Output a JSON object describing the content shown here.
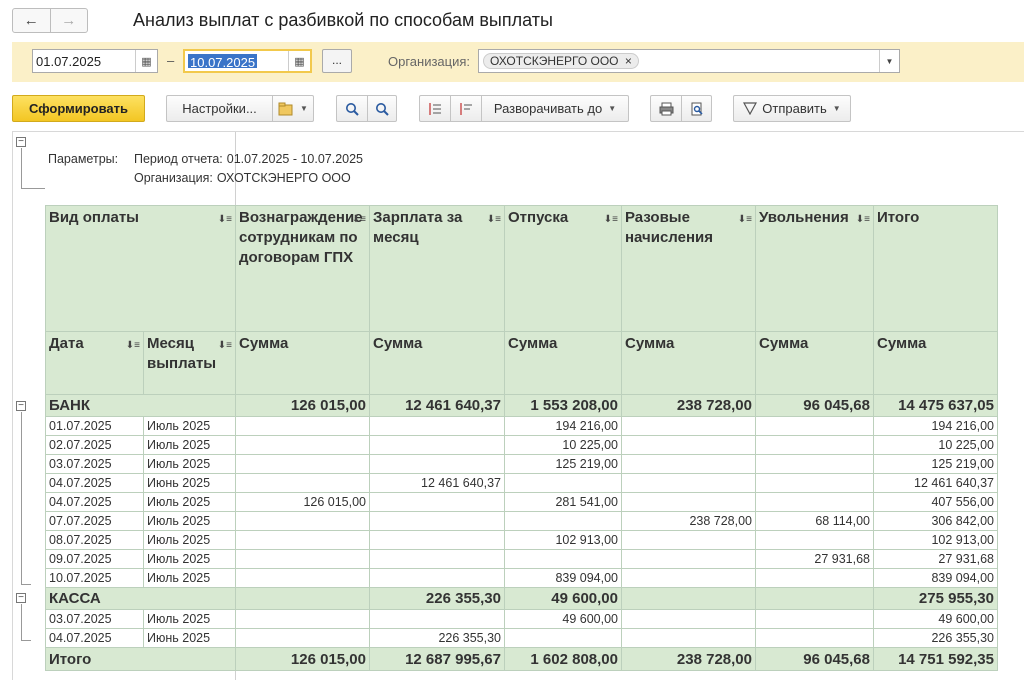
{
  "nav": {
    "back_glyph": "←",
    "fwd_glyph": "→"
  },
  "title": "Анализ выплат с разбивкой по способам выплаты",
  "filters": {
    "date_from": "01.07.2025",
    "date_sep": "–",
    "date_to": "10.07.2025",
    "ellipsis": "...",
    "org_label": "Организация:",
    "org_value": "ОХОТСКЭНЕРГО ООО",
    "org_remove": "×"
  },
  "toolbar": {
    "generate": "Сформировать",
    "settings": "Настройки...",
    "expand_to": "Разворачивать до",
    "send": "Отправить"
  },
  "params": {
    "label": "Параметры:",
    "period_label": "Период отчета:",
    "period_value": "01.07.2025 - 10.07.2025",
    "org_label": "Организация:",
    "org_value": "ОХОТСКЭНЕРГО ООО"
  },
  "table": {
    "headers": {
      "vid": "Вид оплаты",
      "col1": "Вознаграждение сотрудникам по договорам ГПХ",
      "col2": "Зарплата за месяц",
      "col3": "Отпуска",
      "col4": "Разовые начисления",
      "col5": "Увольнения",
      "col6": "Итого",
      "date": "Дата",
      "month": "Месяц выплаты",
      "sum": "Сумма"
    },
    "groups": [
      {
        "name": "БАНК",
        "totals": [
          "126 015,00",
          "12 461 640,37",
          "1 553 208,00",
          "238 728,00",
          "96 045,68",
          "14 475 637,05"
        ],
        "rows": [
          {
            "date": "01.07.2025",
            "month": "Июль 2025",
            "vals": [
              "",
              "",
              "194 216,00",
              "",
              "",
              "194 216,00"
            ]
          },
          {
            "date": "02.07.2025",
            "month": "Июль 2025",
            "vals": [
              "",
              "",
              "10 225,00",
              "",
              "",
              "10 225,00"
            ]
          },
          {
            "date": "03.07.2025",
            "month": "Июль 2025",
            "vals": [
              "",
              "",
              "125 219,00",
              "",
              "",
              "125 219,00"
            ]
          },
          {
            "date": "04.07.2025",
            "month": "Июнь 2025",
            "vals": [
              "",
              "12 461 640,37",
              "",
              "",
              "",
              "12 461 640,37"
            ]
          },
          {
            "date": "04.07.2025",
            "month": "Июль 2025",
            "vals": [
              "126 015,00",
              "",
              "281 541,00",
              "",
              "",
              "407 556,00"
            ]
          },
          {
            "date": "07.07.2025",
            "month": "Июль 2025",
            "vals": [
              "",
              "",
              "",
              "238 728,00",
              "68 114,00",
              "306 842,00"
            ]
          },
          {
            "date": "08.07.2025",
            "month": "Июль 2025",
            "vals": [
              "",
              "",
              "102 913,00",
              "",
              "",
              "102 913,00"
            ]
          },
          {
            "date": "09.07.2025",
            "month": "Июль 2025",
            "vals": [
              "",
              "",
              "",
              "",
              "27 931,68",
              "27 931,68"
            ]
          },
          {
            "date": "10.07.2025",
            "month": "Июль 2025",
            "vals": [
              "",
              "",
              "839 094,00",
              "",
              "",
              "839 094,00"
            ]
          }
        ]
      },
      {
        "name": "КАССА",
        "totals": [
          "",
          "226 355,30",
          "49 600,00",
          "",
          "",
          "275 955,30"
        ],
        "rows": [
          {
            "date": "03.07.2025",
            "month": "Июль 2025",
            "vals": [
              "",
              "",
              "49 600,00",
              "",
              "",
              "49 600,00"
            ]
          },
          {
            "date": "04.07.2025",
            "month": "Июнь 2025",
            "vals": [
              "",
              "226 355,30",
              "",
              "",
              "",
              "226 355,30"
            ]
          }
        ]
      }
    ],
    "total": {
      "label": "Итого",
      "vals": [
        "126 015,00",
        "12 687 995,67",
        "1 602 808,00",
        "238 728,00",
        "96 045,68",
        "14 751 592,35"
      ]
    }
  }
}
